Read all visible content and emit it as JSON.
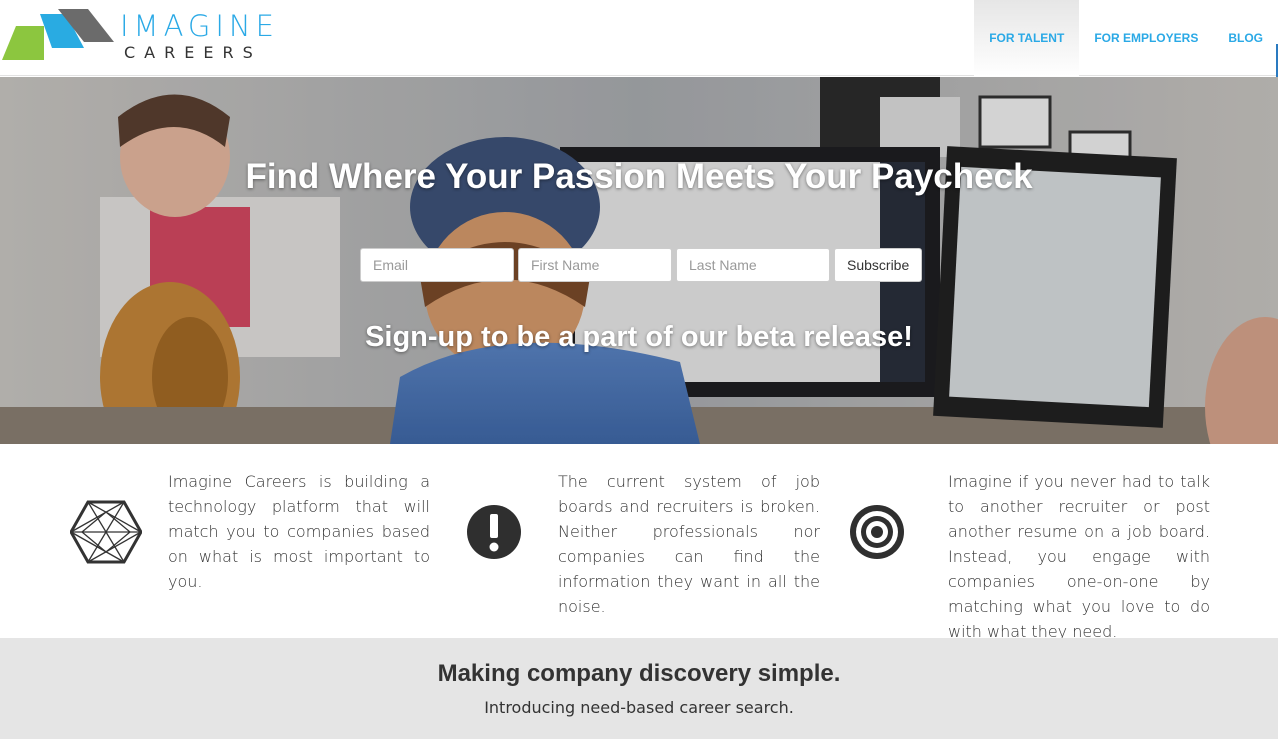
{
  "brand": {
    "word1": "IMAGINE",
    "word2": "CAREERS",
    "colors": {
      "green": "#8cc63f",
      "blue": "#29abe2",
      "gray": "#666666"
    }
  },
  "nav": {
    "items": [
      {
        "label": "FOR TALENT",
        "active": true
      },
      {
        "label": "FOR EMPLOYERS",
        "active": false
      },
      {
        "label": "BLOG",
        "active": false
      }
    ]
  },
  "hero": {
    "title": "Find Where Your Passion Meets Your Paycheck",
    "subtitle": "Sign-up to be a part of our beta release!",
    "form": {
      "email_placeholder": "Email",
      "first_name_placeholder": "First Name",
      "last_name_placeholder": "Last Name",
      "submit_label": "Subscribe"
    }
  },
  "features": [
    {
      "icon": "hexagon-network-icon",
      "text": "Imagine Careers is building a technology platform that will match you to companies based on what is most important to you."
    },
    {
      "icon": "exclamation-circle-icon",
      "text": "The current system of job boards and recruiters is broken. Neither professionals nor companies can find the information they want in all the noise."
    },
    {
      "icon": "target-icon",
      "text": "Imagine if you never had to talk to another recruiter or post another resume on a job board. Instead, you engage with companies one-on-one by matching what you love to do with what they need."
    }
  ],
  "band": {
    "title": "Making company discovery simple.",
    "subtitle": "Introducing need-based career search."
  },
  "colors": {
    "accent": "#2aa9e6",
    "band_background": "#e5e5e5"
  }
}
